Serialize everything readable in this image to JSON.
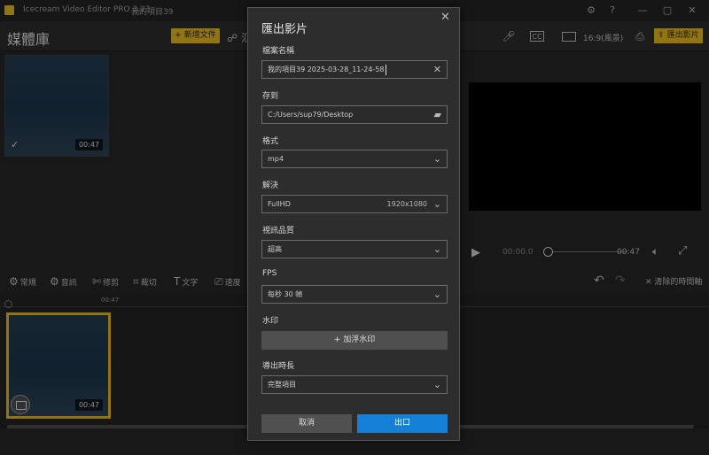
{
  "titlebar": {
    "app_title": "Icecream Video Editor PRO 3.23",
    "project": "我的項目39",
    "gear": "⚙",
    "help": "?",
    "minimize": "—",
    "maximize": "▢",
    "close": "✕"
  },
  "header": {
    "media_title": "媒體庫",
    "add_file": "+ 新增文件",
    "record_partial": "☍ 汇",
    "ratio": "16:9(風景)",
    "export": "匯出影片"
  },
  "media": {
    "duration": "00:47"
  },
  "preview": {
    "time_current": "00:00.0",
    "time_total": "00:47"
  },
  "toolbar": {
    "items": [
      {
        "icon": "⚙",
        "label": "常規"
      },
      {
        "icon": "⚙",
        "label": "音訊"
      },
      {
        "icon": "✄",
        "label": "修剪"
      },
      {
        "icon": "⌗",
        "label": "裁切"
      },
      {
        "icon": "T",
        "label": "文字"
      },
      {
        "icon": "⎚",
        "label": "速度"
      }
    ],
    "clear": "✕ 清除的時間軸"
  },
  "timeline": {
    "ruler_time": "00:47",
    "clip_duration": "00:47"
  },
  "dialog": {
    "title": "匯出影片",
    "filename_label": "檔案名稱",
    "filename_value": "我的項目39 2025-03-28_11-24-58",
    "save_to_label": "存到",
    "save_to_value": "C:/Users/sup79/Desktop",
    "format_label": "格式",
    "format_value": "mp4",
    "resolution_label": "解決",
    "resolution_value": "FullHD",
    "resolution_detail": "1920x1080",
    "quality_label": "視訊品質",
    "quality_value": "超高",
    "fps_label": "FPS",
    "fps_value": "每秒 30 幀",
    "watermark_label": "水印",
    "watermark_button": "+ 加浮水印",
    "duration_label": "導出時長",
    "duration_value": "完整項目",
    "cancel": "取消",
    "export": "出口"
  },
  "colors": {
    "accent": "#e2b21c",
    "primary_button": "#1680d6"
  }
}
